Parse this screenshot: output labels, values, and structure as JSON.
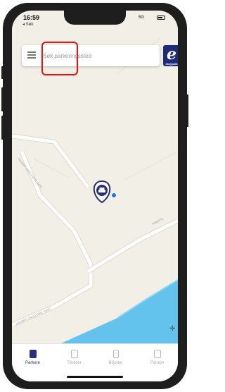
{
  "status": {
    "time": "16:59",
    "back_label": "◂ Søk",
    "signal_text": "5G"
  },
  "search": {
    "placeholder": "Søk parkeringssted"
  },
  "map": {
    "street_1": "HAGEBY CIRCLENINE GATA",
    "street_2": "HAGEBY CIRCLENINE GATE",
    "street_3": "INGESTE"
  },
  "logo": {
    "letter": "e",
    "sub": "easypark"
  },
  "tabs": [
    {
      "label": "Parkere",
      "icon": "parking-icon",
      "active": true
    },
    {
      "label": "Tilbilder",
      "icon": "receipt-icon",
      "active": false
    },
    {
      "label": "Biljetter",
      "icon": "phone-icon",
      "active": false
    },
    {
      "label": "Parabn",
      "icon": "document-icon",
      "active": false
    }
  ],
  "colors": {
    "brand": "#1f2a78",
    "map_bg": "#f1efe6",
    "water": "#63c3ec",
    "location_dot": "#1a73e8",
    "highlight": "#ee1111"
  }
}
